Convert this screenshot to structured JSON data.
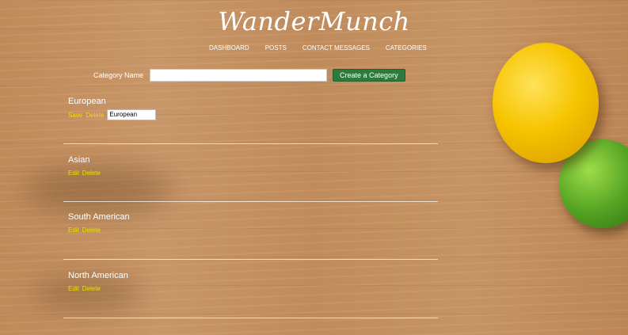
{
  "brand": {
    "logo_text": "WanderMunch"
  },
  "nav": {
    "items": [
      {
        "label": "DASHBOARD"
      },
      {
        "label": "POSTS"
      },
      {
        "label": "CONTACT MESSAGES"
      },
      {
        "label": "CATEGORIES"
      }
    ]
  },
  "create_form": {
    "label": "Category Name",
    "input_value": "",
    "button_label": "Create a Category"
  },
  "categories": [
    {
      "name": "European",
      "editing": true,
      "save_label": "Save",
      "delete_label": "Delete",
      "field_value": "European"
    },
    {
      "name": "Asian",
      "edit_label": "Edit",
      "delete_label": "Delete"
    },
    {
      "name": "South American",
      "edit_label": "Edit",
      "delete_label": "Delete"
    },
    {
      "name": "North American",
      "edit_label": "Edit",
      "delete_label": "Delete"
    }
  ],
  "colors": {
    "action_link": "#e9e000",
    "button_green": "#2e7a3c"
  }
}
